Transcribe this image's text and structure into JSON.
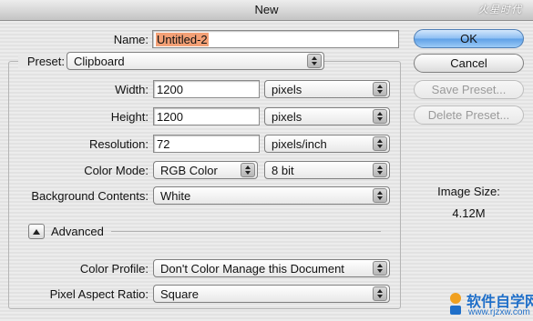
{
  "window": {
    "title": "New"
  },
  "watermark_top": "火星时代",
  "name": {
    "label": "Name:",
    "value": "Untitled-2"
  },
  "preset": {
    "label": "Preset:",
    "value": "Clipboard"
  },
  "width": {
    "label": "Width:",
    "value": "1200",
    "unit": "pixels"
  },
  "height": {
    "label": "Height:",
    "value": "1200",
    "unit": "pixels"
  },
  "resolution": {
    "label": "Resolution:",
    "value": "72",
    "unit": "pixels/inch"
  },
  "color_mode": {
    "label": "Color Mode:",
    "value": "RGB Color",
    "depth": "8 bit"
  },
  "background": {
    "label": "Background Contents:",
    "value": "White"
  },
  "advanced": {
    "label": "Advanced"
  },
  "color_profile": {
    "label": "Color Profile:",
    "value": "Don't Color Manage this Document"
  },
  "pixel_aspect": {
    "label": "Pixel Aspect Ratio:",
    "value": "Square"
  },
  "buttons": {
    "ok": "OK",
    "cancel": "Cancel",
    "save_preset": "Save Preset...",
    "delete_preset": "Delete Preset..."
  },
  "image_size": {
    "label": "Image Size:",
    "value": "4.12M"
  },
  "watermark_bottom": {
    "text": "软件自学网",
    "url": "www.rjzxw.com"
  },
  "colors": {
    "selection": "#f3a076",
    "default_button": "#5e9fe6",
    "watermark": "#1f6fc9"
  }
}
